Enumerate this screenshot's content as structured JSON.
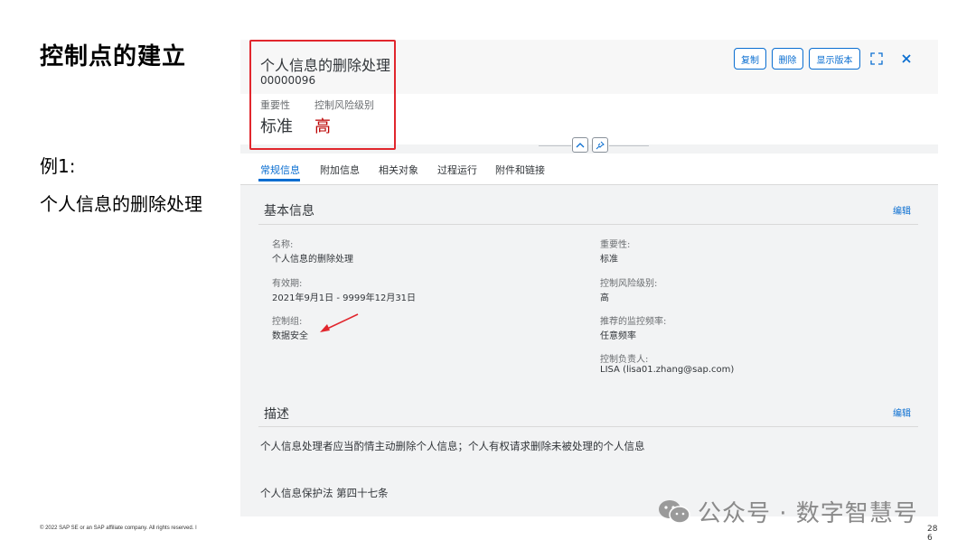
{
  "slide": {
    "title": "控制点的建立",
    "example_label": "例1:",
    "example_desc": "个人信息的删除处理",
    "copyright": "© 2022 SAP SE or an SAP affiliate company. All rights reserved.  ǀ",
    "page_number": "28\n6",
    "watermark": "公众号 · 数字智慧号"
  },
  "app": {
    "header": {
      "title": "个人信息的删除处理",
      "id": "00000096",
      "importance_label": "重要性",
      "importance_value": "标准",
      "risk_label": "控制风险级别",
      "risk_value": "高",
      "buttons": {
        "copy": "复制",
        "delete": "删除",
        "show_version": "显示版本"
      },
      "icons": {
        "fullscreen": "fullscreen-icon",
        "close": "close-icon",
        "collapse": "chevron-up-icon",
        "pin": "pin-icon"
      }
    },
    "tabs": [
      "常规信息",
      "附加信息",
      "相关对象",
      "过程运行",
      "附件和链接"
    ],
    "basic_info": {
      "title": "基本信息",
      "edit": "编辑",
      "left_fields": [
        {
          "label": "名称:",
          "value": "个人信息的删除处理"
        },
        {
          "label": "有效期:",
          "value": "2021年9月1日 - 9999年12月31日"
        },
        {
          "label": "控制组:",
          "value": "数据安全"
        }
      ],
      "right_fields": [
        {
          "label": "重要性:",
          "value": "标准"
        },
        {
          "label": "控制风险级别:",
          "value": "高"
        },
        {
          "label": "推荐的监控频率:",
          "value": "任意频率"
        },
        {
          "label": "控制负责人:",
          "value": "LISA (lisa01.zhang@sap.com)"
        }
      ]
    },
    "description": {
      "title": "描述",
      "edit": "编辑",
      "text": "个人信息处理者应当酌情主动删除个人信息；个人有权请求删除未被处理的个人信息",
      "law_ref": "个人信息保护法 第四十七条"
    },
    "colors": {
      "accent": "#0a6ed1",
      "risk_high": "#bb0000",
      "highlight_box": "#e1262d",
      "arrow": "#e1262d"
    }
  }
}
